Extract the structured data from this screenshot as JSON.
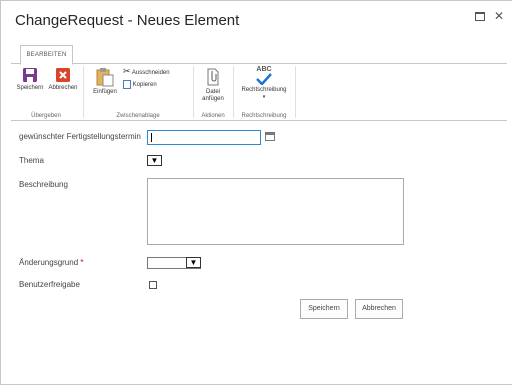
{
  "dialog": {
    "title": "ChangeRequest - Neues Element",
    "close_glyph": "✕"
  },
  "ribbon": {
    "tab_label": "BEARBEITEN",
    "groups": {
      "submit": {
        "label": "Übergeben",
        "save": "Speichern",
        "cancel": "Abbrechen"
      },
      "clipboard": {
        "label": "Zwischenablage",
        "paste": "Einfügen",
        "cut": "Ausschneiden",
        "copy": "Kopieren"
      },
      "actions": {
        "label": "Aktionen",
        "attach_line1": "Datei",
        "attach_line2": "anfügen"
      },
      "spelling": {
        "label": "Rechtschreibung",
        "spelling": "Rechtschreibung",
        "abc": "ABC"
      }
    }
  },
  "form": {
    "due_date_label": "gewünschter Fertigstellungstermin",
    "due_date_value": "",
    "topic_label": "Thema",
    "description_label": "Beschreibung",
    "reason_label": "Änderungsgrund",
    "required_marker": "*",
    "approval_label": "Benutzerfreigabe",
    "save_button": "Speichern",
    "cancel_button": "Abbrechen"
  },
  "colors": {
    "save_icon": "#7a3b8f",
    "cancel_icon": "#d9452b",
    "check_icon": "#1e73d6",
    "focus_border": "#2a8ad4"
  }
}
